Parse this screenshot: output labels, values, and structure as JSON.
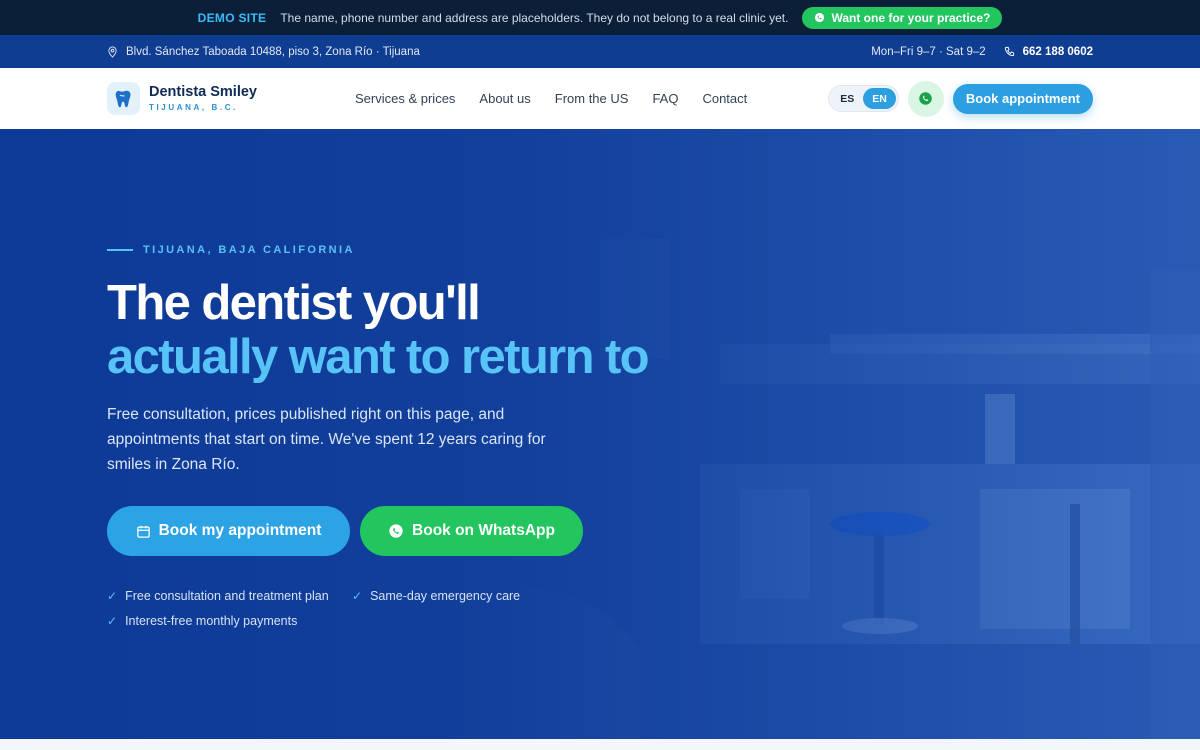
{
  "demo": {
    "tag": "DEMO SITE",
    "message": "The name, phone number and address are placeholders. They do not belong to a real clinic yet.",
    "cta": "Want one for your practice?"
  },
  "info": {
    "address": "Blvd. Sánchez Taboada 10488, piso 3, Zona Río · Tijuana",
    "hours": "Mon–Fri 9–7 · Sat 9–2",
    "phone": "662 188 0602"
  },
  "brand": {
    "name": "Dentista Smiley",
    "subtitle": "TIJUANA, B.C."
  },
  "nav": {
    "items": [
      "Services & prices",
      "About us",
      "From the US",
      "FAQ",
      "Contact"
    ],
    "languages": [
      "ES",
      "EN"
    ],
    "active_language": "EN",
    "book_label": "Book appointment"
  },
  "hero": {
    "eyebrow": "TIJUANA, BAJA CALIFORNIA",
    "title_line1": "The dentist you'll",
    "title_line2": "actually want to return to",
    "lead": "Free consultation, prices published right on this page, and appointments that start on time. We've spent 12 years caring for smiles in Zona Río.",
    "cta_primary": "Book my appointment",
    "cta_whatsapp": "Book on WhatsApp",
    "checks": [
      "Free consultation and treatment plan",
      "Same-day emergency care",
      "Interest-free monthly payments"
    ]
  },
  "colors": {
    "accent": "#2b9fe0",
    "whatsapp": "#22c55e",
    "hero_bg": "#0d3a96",
    "title_highlight": "#58c3f6",
    "demo_bar": "#0c1f38",
    "info_bar": "#0f3d91"
  },
  "icons": {
    "whatsapp": "whatsapp-icon",
    "location": "map-pin-icon",
    "phone": "phone-icon",
    "calendar": "calendar-icon",
    "check": "check-icon",
    "logo": "tooth-icon"
  }
}
